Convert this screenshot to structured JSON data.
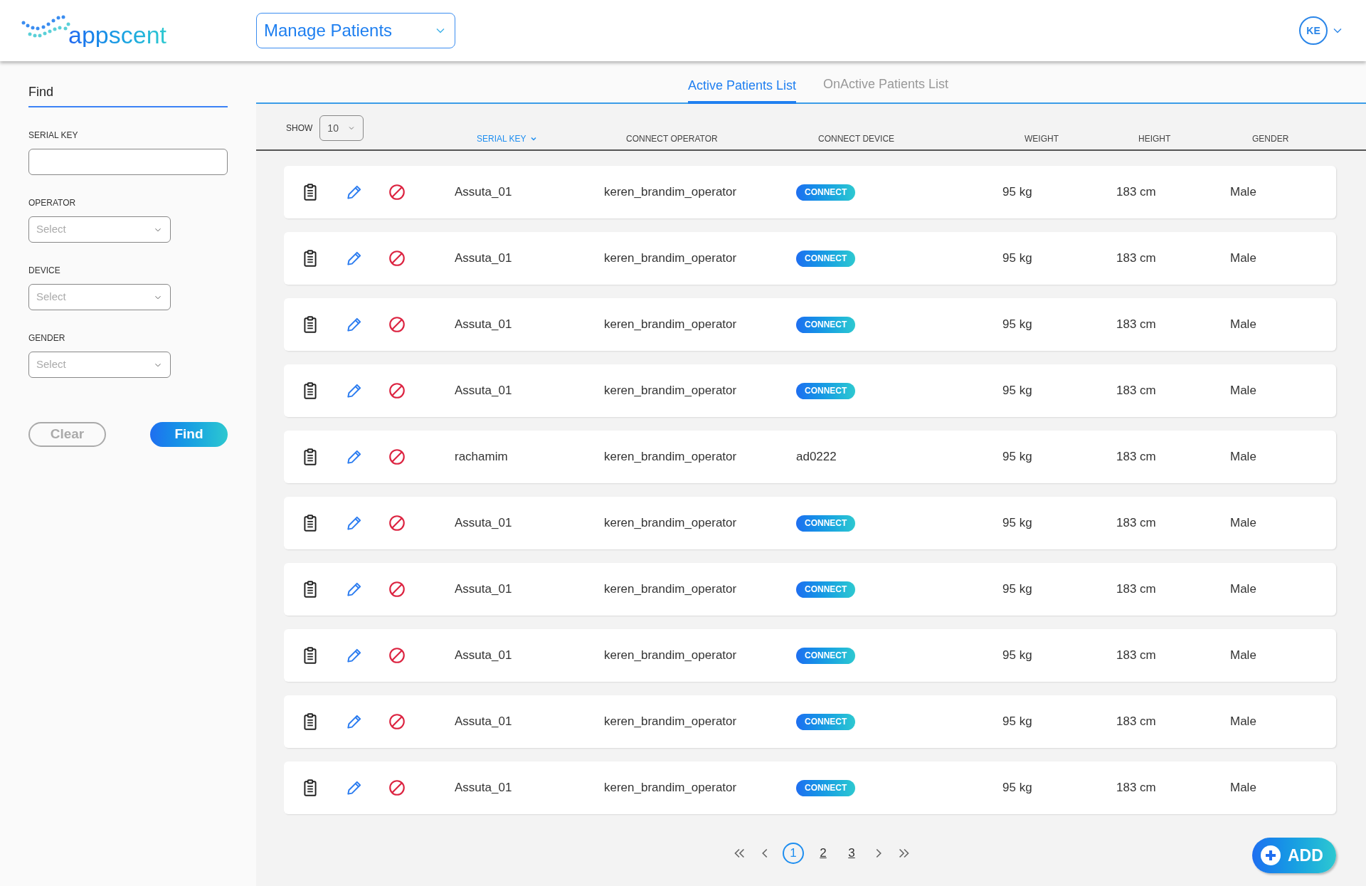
{
  "header": {
    "logo": "appscent",
    "module_select": "Manage Patients",
    "user_initials": "KE"
  },
  "sidebar": {
    "title": "Find",
    "filters": [
      {
        "label": "SERIAL KEY",
        "kind": "text"
      },
      {
        "label": "OPERATOR",
        "kind": "select",
        "placeholder": "Select"
      },
      {
        "label": "DEVICE",
        "kind": "select",
        "placeholder": "Select"
      },
      {
        "label": "GENDER",
        "kind": "select",
        "placeholder": "Select"
      }
    ],
    "buttons": [
      {
        "label": "Clear",
        "kind": "secondary"
      },
      {
        "label": "Find",
        "kind": "primary"
      }
    ]
  },
  "tabs": [
    {
      "label": "Active Patients List",
      "selected": true
    },
    {
      "label": "OnActive Patients List",
      "selected": false
    }
  ],
  "show": {
    "label": "SHOW",
    "value": "10"
  },
  "table": {
    "columns": [
      {
        "label": "SERIAL KEY",
        "sorted": true
      },
      {
        "label": "CONNECT OPERATOR",
        "sorted": false
      },
      {
        "label": "CONNECT DEVICE",
        "sorted": false
      },
      {
        "label": "WEIGHT",
        "sorted": false
      },
      {
        "label": "HEIGHT",
        "sorted": false
      },
      {
        "label": "GENDER",
        "sorted": false
      }
    ],
    "rows": [
      {
        "serial_key": "Assuta_01",
        "operator": "keren_brandim_operator",
        "device": {
          "kind": "button",
          "text": "CONNECT"
        },
        "weight": "95 kg",
        "height": "183 cm",
        "gender": "Male"
      },
      {
        "serial_key": "Assuta_01",
        "operator": "keren_brandim_operator",
        "device": {
          "kind": "button",
          "text": "CONNECT"
        },
        "weight": "95 kg",
        "height": "183 cm",
        "gender": "Male"
      },
      {
        "serial_key": "Assuta_01",
        "operator": "keren_brandim_operator",
        "device": {
          "kind": "button",
          "text": "CONNECT"
        },
        "weight": "95 kg",
        "height": "183 cm",
        "gender": "Male"
      },
      {
        "serial_key": "Assuta_01",
        "operator": "keren_brandim_operator",
        "device": {
          "kind": "button",
          "text": "CONNECT"
        },
        "weight": "95 kg",
        "height": "183 cm",
        "gender": "Male"
      },
      {
        "serial_key": "rachamim",
        "operator": "keren_brandim_operator",
        "device": {
          "kind": "text",
          "text": "ad0222"
        },
        "weight": "95 kg",
        "height": "183 cm",
        "gender": "Male"
      },
      {
        "serial_key": "Assuta_01",
        "operator": "keren_brandim_operator",
        "device": {
          "kind": "button",
          "text": "CONNECT"
        },
        "weight": "95 kg",
        "height": "183 cm",
        "gender": "Male"
      },
      {
        "serial_key": "Assuta_01",
        "operator": "keren_brandim_operator",
        "device": {
          "kind": "button",
          "text": "CONNECT"
        },
        "weight": "95 kg",
        "height": "183 cm",
        "gender": "Male"
      },
      {
        "serial_key": "Assuta_01",
        "operator": "keren_brandim_operator",
        "device": {
          "kind": "button",
          "text": "CONNECT"
        },
        "weight": "95 kg",
        "height": "183 cm",
        "gender": "Male"
      },
      {
        "serial_key": "Assuta_01",
        "operator": "keren_brandim_operator",
        "device": {
          "kind": "button",
          "text": "CONNECT"
        },
        "weight": "95 kg",
        "height": "183 cm",
        "gender": "Male"
      },
      {
        "serial_key": "Assuta_01",
        "operator": "keren_brandim_operator",
        "device": {
          "kind": "button",
          "text": "CONNECT"
        },
        "weight": "95 kg",
        "height": "183 cm",
        "gender": "Male"
      }
    ]
  },
  "pagination": {
    "pages": [
      {
        "label": "1",
        "selected": true
      },
      {
        "label": "2",
        "selected": false
      },
      {
        "label": "3",
        "selected": false
      }
    ]
  },
  "add_button": "ADD"
}
